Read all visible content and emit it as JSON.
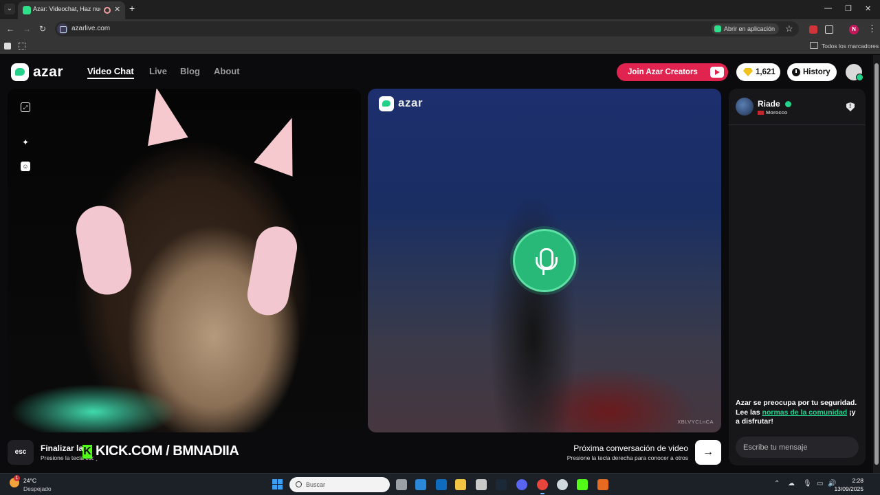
{
  "browser": {
    "tab_title": "Azar: Videochat, Haz nuevo",
    "url": "azarlive.com",
    "open_in_app": "Abrir en aplicación",
    "bookmarks_all": "Todos los marcadores",
    "profile_initial": "N"
  },
  "header": {
    "logo_text": "azar",
    "nav": [
      "Video Chat",
      "Live",
      "Blog",
      "About"
    ],
    "creators_label": "Join Azar Creators",
    "gems_count": "1,621",
    "history_label": "History"
  },
  "remote": {
    "logo_text": "azar",
    "watermark_id": "XBLVYCLnCA",
    "mic_state": "muted-audio-only"
  },
  "chat": {
    "peer_name": "Riade",
    "peer_country": "Morocco",
    "safety_prefix": "Azar se preocupa por tu seguridad. Lee las ",
    "safety_link": "normas de la comunidad",
    "safety_suffix": " ¡y a disfrutar!",
    "input_placeholder": "Escribe tu mensaje"
  },
  "controls": {
    "esc_label": "esc",
    "finalize_title": "Finalizar la",
    "finalize_sub": "Presione la tecla esc para finalizar el chat de video",
    "overlay_k": "K",
    "overlay_text": "KICK.COM / BMNADIIA",
    "next_title": "Próxima conversación de video",
    "next_sub": "Presione la tecla derecha para conocer a otros",
    "next_arrow": "→"
  },
  "taskbar": {
    "temp": "24°C",
    "weather": "Despejado",
    "weather_badge": "1",
    "search_placeholder": "Buscar",
    "time": "2:28",
    "date": "13/09/2025"
  },
  "colors": {
    "accent_green": "#23d18b",
    "creators_red": "#e0244f",
    "gem_yellow": "#f2c21b"
  }
}
